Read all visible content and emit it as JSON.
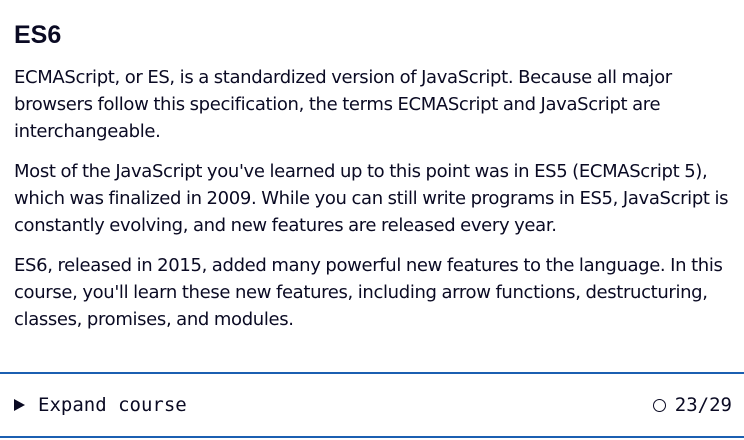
{
  "heading": "ES6",
  "paragraphs": [
    "ECMAScript, or ES, is a standardized version of JavaScript. Because all major browsers follow this specification, the terms ECMAScript and JavaScript are interchangeable.",
    "Most of the JavaScript you've learned up to this point was in ES5 (ECMAScript 5), which was finalized in 2009. While you can still write programs in ES5, JavaScript is constantly evolving, and new features are released every year.",
    "ES6, released in 2015, added many powerful new features to the language. In this course, you'll learn these new features, including arrow functions, destructuring, classes, promises, and modules."
  ],
  "course_bar": {
    "expand_label": "Expand course",
    "expand_icon": "caret-right-icon",
    "progress_icon": "circle-outline-icon",
    "progress_text": "23/29"
  },
  "colors": {
    "text": "#0a0a23",
    "border_accent": "#1b5fb1"
  }
}
